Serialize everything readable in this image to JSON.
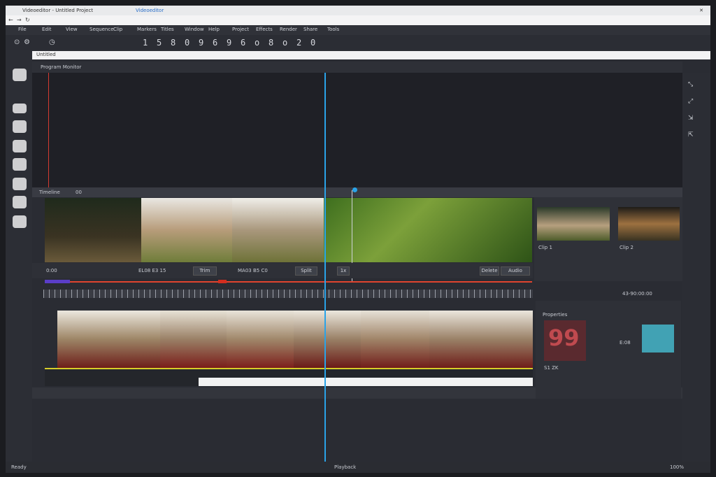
{
  "browser": {
    "tab_title": "Videoeditor - Untitled Project",
    "tab_url": "Videoeditor",
    "address": "Untitled"
  },
  "menu": [
    "File",
    "Edit",
    "View",
    "Sequence",
    "Clip",
    "Markers",
    "Titles",
    "Window",
    "Help",
    "Project",
    "Effects",
    "Render",
    "Share",
    "Tools"
  ],
  "toolbar_items": [
    "1",
    "5",
    "8",
    "0",
    "9",
    "6",
    "9",
    "6",
    "o",
    "8",
    "o",
    "2",
    "0"
  ],
  "viewer": {
    "header": "Program Monitor"
  },
  "track": {
    "header_label": "Timeline",
    "header_value": "00"
  },
  "controls": {
    "left_time": "0:00",
    "btn1": "Trim",
    "mid_time": "EL08 E3 15",
    "btn2": "Split",
    "right_label": "MA03 B5 C0",
    "btn3": "Delete",
    "speed": "1x",
    "btn4": "Audio"
  },
  "right_panel": {
    "thumb1_caption": "Clip 1",
    "thumb2_caption": "Clip 2",
    "timecode": "43-90:00:00"
  },
  "inspector": {
    "title": "Properties",
    "number": "99",
    "value": "E:08",
    "caption": "S1 ZK"
  },
  "statusbar": {
    "left": "Ready",
    "center_icons": "Playback",
    "right": "100%"
  },
  "colors": {
    "playhead": "#2aa3e8",
    "accent_red": "#e0442e"
  }
}
